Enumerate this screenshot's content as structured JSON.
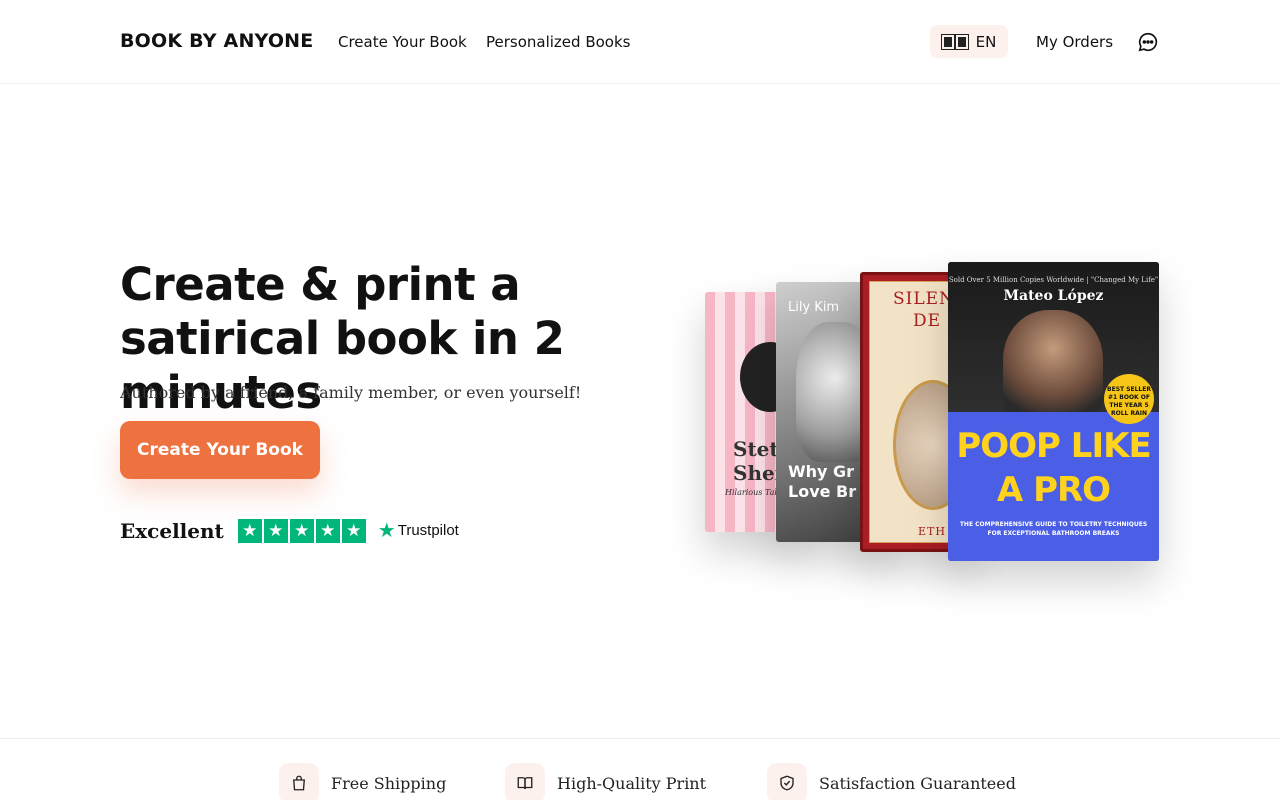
{
  "header": {
    "logo": "BOOK BY ANYONE",
    "nav": [
      "Create Your Book",
      "Personalized Books"
    ],
    "language": "EN",
    "orders": "My Orders"
  },
  "hero": {
    "title": "Create & print a satirical book in 2 minutes",
    "subtitle": "Authored by a friend, a family member, or even yourself!",
    "cta": "Create Your Book",
    "rating_word": "Excellent",
    "rating_stars": 5,
    "trustpilot": "Trustpilot"
  },
  "books": {
    "book1": {
      "title": "Stetl Shen",
      "subtitle": "Hilarious Tale"
    },
    "book2": {
      "author": "Lily Kim",
      "title": "Why Gr Love Br"
    },
    "book3": {
      "title_line1": "SILEN",
      "title_line2": "DE",
      "author": "ETH"
    },
    "book4": {
      "tagline": "Sold Over 5 Million Copies Worldwide | \"Changed My Life\"",
      "author": "Mateo López",
      "badge": "BEST SELLER #1 BOOK OF THE YEAR 5 ROLL RAIN",
      "title": "POOP LIKE A PRO",
      "subtitle": "THE COMPREHENSIVE GUIDE TO TOILETRY TECHNIQUES FOR EXCEPTIONAL BATHROOM BREAKS"
    }
  },
  "features": [
    "Free Shipping",
    "High-Quality Print",
    "Satisfaction Guaranteed"
  ],
  "colors": {
    "accent": "#ee7140",
    "trustpilot_green": "#00b67a",
    "pale_accent": "#fdf1ee"
  }
}
